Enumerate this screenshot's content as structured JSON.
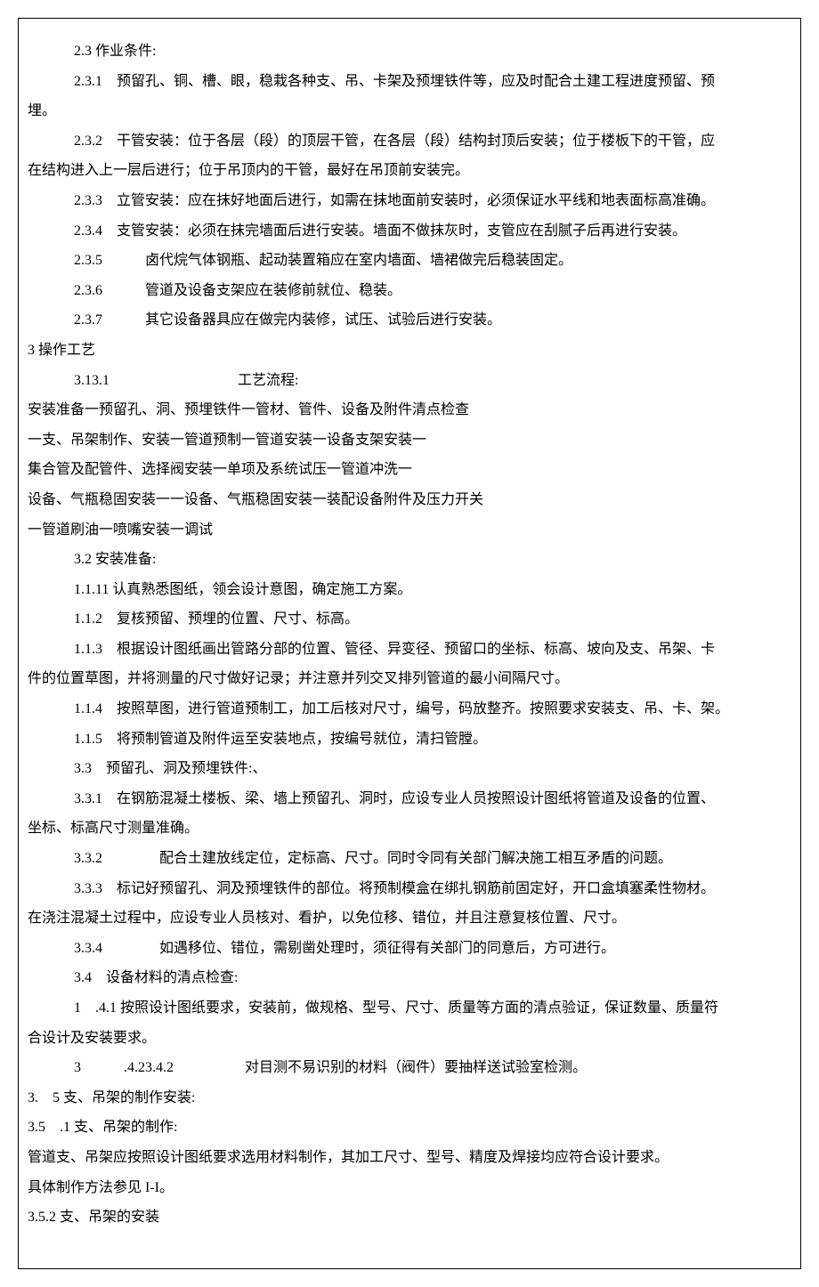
{
  "lines": [
    {
      "cls": "para-indent1",
      "t": "2.3 作业条件:"
    },
    {
      "cls": "para-indent1",
      "t": "2.3.1　预留孔、铜、槽、眼，稳栽各种支、吊、卡架及预埋铁件等，应及时配合土建工程进度预留、预"
    },
    {
      "cls": "para-hang",
      "t": "埋。"
    },
    {
      "cls": "para-indent1",
      "t": "2.3.2　干管安装：位于各层（段）的顶层干管，在各层（段）结构封顶后安装；位于楼板下的干管，应"
    },
    {
      "cls": "para-hang",
      "t": "在结构进入上一层后进行；位于吊顶内的干管，最好在吊顶前安装完。"
    },
    {
      "cls": "para-indent1",
      "t": "2.3.3　立管安装：应在抹好地面后进行，如需在抹地面前安装时，必须保证水平线和地表面标高准确。"
    },
    {
      "cls": "para-indent1",
      "t": "2.3.4　支管安装：必须在抹完墙面后进行安装。墙面不做抹灰时，支管应在刮腻子后再进行安装。"
    },
    {
      "cls": "para-indent1",
      "t": "2.3.5　　　卤代烷气体钢瓶、起动装置箱应在室内墙面、墙裙做完后稳装固定。"
    },
    {
      "cls": "para-indent1",
      "t": "2.3.6　　　管道及设备支架应在装修前就位、稳装。"
    },
    {
      "cls": "para-indent1",
      "t": "2.3.7　　　其它设备器具应在做完内装修，试压、试验后进行安装。"
    },
    {
      "cls": "para-noindent",
      "t": "3 操作工艺"
    },
    {
      "cls": "para-indent1",
      "t": "3.13.1　　　　　　　　　工艺流程:"
    },
    {
      "cls": "para-noindent",
      "t": "安装准备一预留孔、洞、预埋铁件一管材、管件、设备及附件清点检查"
    },
    {
      "cls": "para-noindent",
      "t": "一支、吊架制作、安装一管道预制一管道安装一设备支架安装一"
    },
    {
      "cls": "para-noindent",
      "t": "集合管及配管件、选择阀安装一单项及系统试压一管道冲洗一"
    },
    {
      "cls": "para-noindent",
      "t": "设备、气瓶稳固安装一一设备、气瓶稳固安装一装配设备附件及压力开关"
    },
    {
      "cls": "para-noindent",
      "t": "一管道刷油一喷嘴安装一调试"
    },
    {
      "cls": "para-indent1",
      "t": "3.2 安装准备:"
    },
    {
      "cls": "para-indent1",
      "t": "1.1.11 认真熟悉图纸，领会设计意图，确定施工方案。"
    },
    {
      "cls": "para-indent1",
      "t": "1.1.2　复核预留、预埋的位置、尺寸、标高。"
    },
    {
      "cls": "para-indent1",
      "t": "1.1.3　根据设计图纸画出管路分部的位置、管径、异变径、预留口的坐标、标高、坡向及支、吊架、卡"
    },
    {
      "cls": "para-hang",
      "t": "件的位置草图，并将测量的尺寸做好记录；并注意并列交叉排列管道的最小间隔尺寸。"
    },
    {
      "cls": "para-indent1",
      "t": "1.1.4　按照草图，进行管道预制工，加工后核对尺寸，编号，码放整齐。按照要求安装支、吊、卡、架。"
    },
    {
      "cls": "para-indent1",
      "t": "1.1.5　将预制管道及附件运至安装地点，按编号就位，清扫管膛。"
    },
    {
      "cls": "para-indent1",
      "t": "3.3　预留孔、洞及预埋铁件:、"
    },
    {
      "cls": "para-indent1",
      "t": "3.3.1　在钢筋混凝土楼板、梁、墙上预留孔、洞时，应设专业人员按照设计图纸将管道及设备的位置、"
    },
    {
      "cls": "para-hang",
      "t": "坐标、标高尺寸测量准确。"
    },
    {
      "cls": "para-indent1",
      "t": "3.3.2　　　　配合土建放线定位，定标高、尺寸。同时令同有关部门解决施工相互矛盾的问题。"
    },
    {
      "cls": "para-indent1",
      "t": "3.3.3　标记好预留孔、洞及预埋铁件的部位。将预制模盒在绑扎钢筋前固定好，开口盒填塞柔性物材。"
    },
    {
      "cls": "para-hang",
      "t": "在浇注混凝土过程中，应设专业人员核对、看护，以免位移、错位，并且注意复核位置、尺寸。"
    },
    {
      "cls": "para-indent1",
      "t": "3.3.4　　　　如遇移位、错位，需剔凿处理时，须征得有关部门的同意后，方可进行。"
    },
    {
      "cls": "para-indent1",
      "t": "3.4　设备材料的清点检查:"
    },
    {
      "cls": "para-indent1",
      "t": "1　.4.1 按照设计图纸要求，安装前，做规格、型号、尺寸、质量等方面的清点验证，保证数量、质量符"
    },
    {
      "cls": "para-hang",
      "t": "合设计及安装要求。"
    },
    {
      "cls": "para-indent1",
      "t": "3　　　.4.23.4.2　　　　　对目测不易识别的材料（阀件）要抽样送试验室检测。"
    },
    {
      "cls": "para-noindent",
      "t": "3.　5 支、吊架的制作安装:"
    },
    {
      "cls": "para-noindent",
      "t": "3.5　.1 支、吊架的制作:"
    },
    {
      "cls": "para-noindent",
      "t": "管道支、吊架应按照设计图纸要求选用材料制作，其加工尺寸、型号、精度及焊接均应符合设计要求。"
    },
    {
      "cls": "para-noindent",
      "t": "具体制作方法参见 I-I。"
    },
    {
      "cls": "para-noindent",
      "t": "3.5.2 支、吊架的安装"
    }
  ]
}
